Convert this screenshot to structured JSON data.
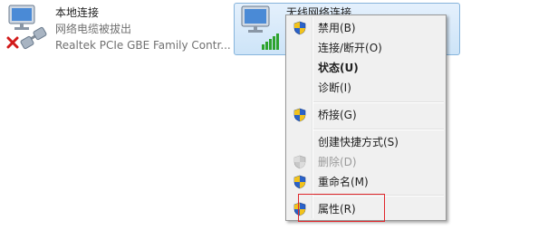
{
  "local_connection": {
    "name": "本地连接",
    "status": "网络电缆被拔出",
    "adapter": "Realtek PCIe GBE Family Contr..."
  },
  "wireless_connection": {
    "name": "无线网络连接"
  },
  "context_menu": {
    "items": [
      {
        "label": "禁用(B)",
        "shield": true
      },
      {
        "label": "连接/断开(O)",
        "shield": false
      },
      {
        "label": "状态(U)",
        "shield": false,
        "bold": true
      },
      {
        "label": "诊断(I)",
        "shield": false
      },
      {
        "label": "桥接(G)",
        "shield": true
      },
      {
        "label": "创建快捷方式(S)",
        "shield": false
      },
      {
        "label": "删除(D)",
        "shield": true,
        "disabled": true
      },
      {
        "label": "重命名(M)",
        "shield": true
      },
      {
        "label": "属性(R)",
        "shield": true
      }
    ]
  },
  "colors": {
    "highlight_box": "#e0262b",
    "shield_blue": "#2a62c9",
    "shield_yellow": "#f2c21b"
  }
}
